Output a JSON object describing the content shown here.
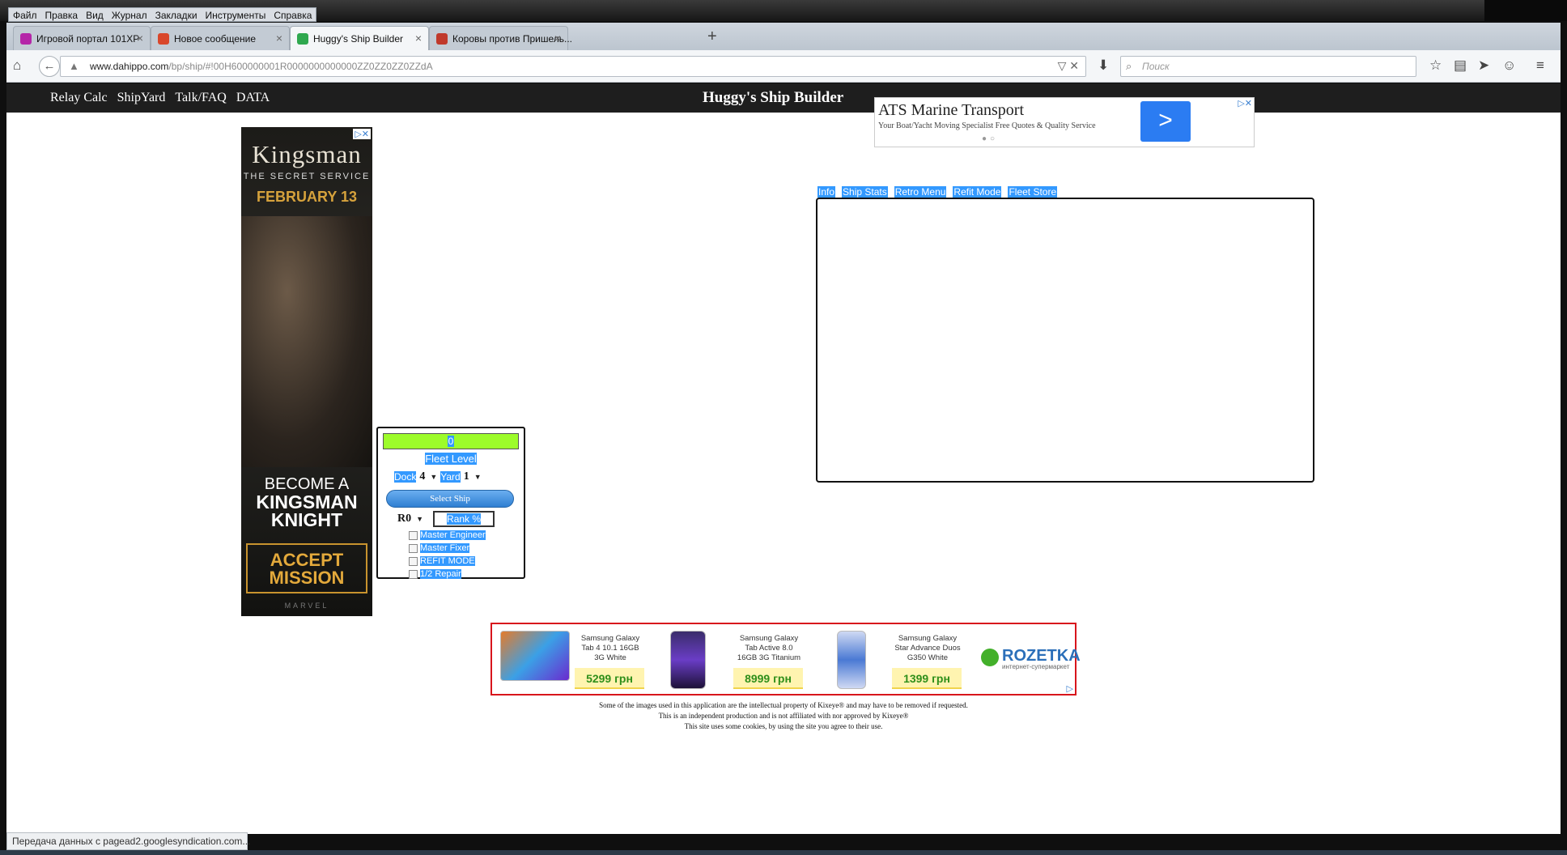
{
  "menu": [
    "Файл",
    "Правка",
    "Вид",
    "Журнал",
    "Закладки",
    "Инструменты",
    "Справка"
  ],
  "tabs": [
    {
      "label": "Игровой портал 101XP",
      "icon_color": "#b526a8"
    },
    {
      "label": "Новое сообщение",
      "icon_color": "#d9472b"
    },
    {
      "label": "Huggy's Ship Builder",
      "icon_color": "#2fa84f"
    },
    {
      "label": "Коровы против Пришель...",
      "icon_color": "#c0392b"
    }
  ],
  "new_tab_label": "+",
  "url_host": "www.dahippo.com",
  "url_path": "/bp/ship/#!00H600000001R0000000000000ZZ0ZZ0ZZ0ZZdA",
  "search_placeholder": "Поиск",
  "site": {
    "nav": [
      "Relay Calc",
      "ShipYard",
      "Talk/FAQ",
      "DATA"
    ],
    "title": "Huggy's Ship Builder"
  },
  "kingsman_ad": {
    "title": "Kingsman",
    "subtitle": "THE SECRET SERVICE",
    "date": "FEBRUARY 13",
    "line1": "BECOME A",
    "line2": "KINGSMAN KNIGHT",
    "button": "ACCEPT MISSION",
    "footer": "MARVEL"
  },
  "fleet": {
    "value": "0",
    "label": "Fleet Level",
    "dock_label": "Dock",
    "dock_value": "4",
    "yard_label": "Yard",
    "yard_value": "1",
    "select_ship": "Select Ship",
    "rank_value": "R0",
    "rank_placeholder": "Rank %",
    "checkboxes": [
      "Master Engineer",
      "Master Fixer",
      "REFIT MODE",
      "1/2 Repair"
    ]
  },
  "ats_ad": {
    "title": "ATS Marine Transport",
    "subtitle": "Your Boat/Yacht Moving Specialist Free Quotes & Quality Service",
    "arrow": ">"
  },
  "view_tabs": [
    "Info",
    "Ship Stats",
    "Retro Menu",
    "Refit Mode",
    "Fleet Store"
  ],
  "samsung_ad": {
    "products": [
      {
        "name": "Samsung Galaxy Tab 4 10.1 16GB 3G White",
        "price": "5299 грн"
      },
      {
        "name": "Samsung Galaxy Tab Active 8.0 16GB 3G Titanium",
        "price": "8999 грн"
      },
      {
        "name": "Samsung Galaxy Star Advance Duos G350 White",
        "price": "1399 грн"
      }
    ],
    "brand": "ROZETKA",
    "brand_sub": "интернет-супермаркет"
  },
  "disclaimer": [
    "Some of the images used in this application are the intellectual property of Kixeye® and may have to be removed if requested.",
    "This is an independent production and is not affiliated with nor approved by Kixeye®",
    "This site uses some cookies, by using the site you agree to their use."
  ],
  "status_text": "Передача данных с pagead2.googlesyndication.com..."
}
